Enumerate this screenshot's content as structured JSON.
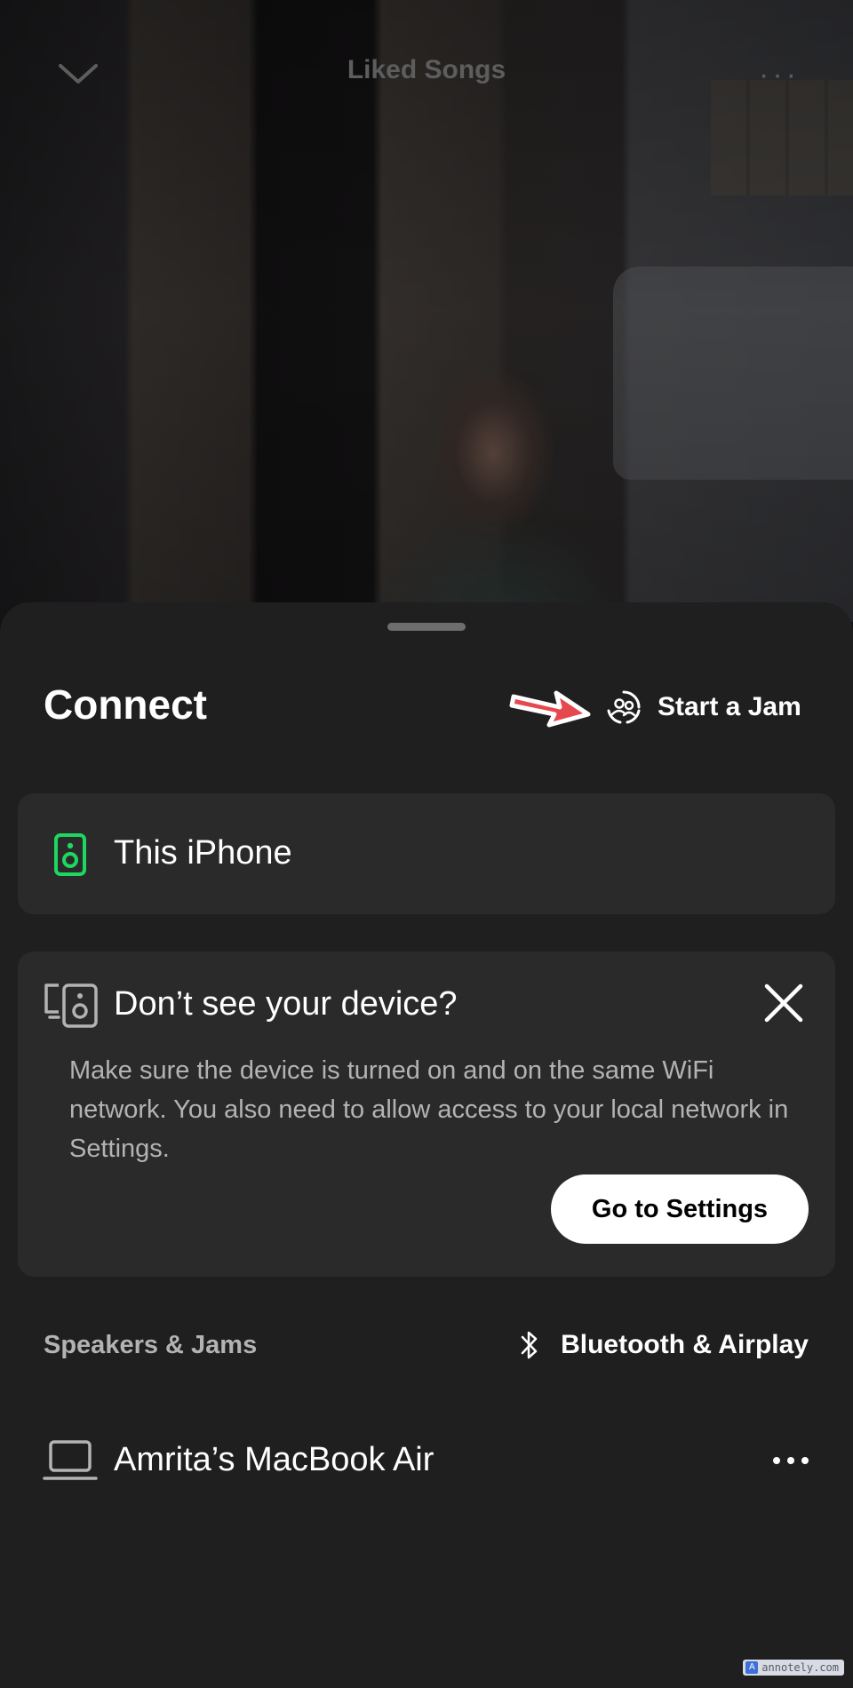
{
  "now_playing": {
    "title": "Liked Songs",
    "more_label": "···"
  },
  "connect_sheet": {
    "title": "Connect",
    "jam_button_label": "Start a Jam",
    "current_device": {
      "label": "This iPhone",
      "icon": "speaker-icon",
      "active_color": "#1ed760"
    },
    "help_card": {
      "title": "Don’t see your device?",
      "body": "Make sure the device is turned on and on the same WiFi network. You also need to allow access to your local network in Settings.",
      "settings_button_label": "Go to Settings"
    },
    "speakers_section": {
      "label": "Speakers & Jams",
      "bluetooth_link_label": "Bluetooth & Airplay"
    },
    "devices": [
      {
        "label": "Amrita’s MacBook Air",
        "icon": "laptop-icon",
        "more_label": "···"
      }
    ]
  },
  "annotation": {
    "arrow_color": "#e5484d"
  },
  "watermark": {
    "text": "annotely.com"
  }
}
